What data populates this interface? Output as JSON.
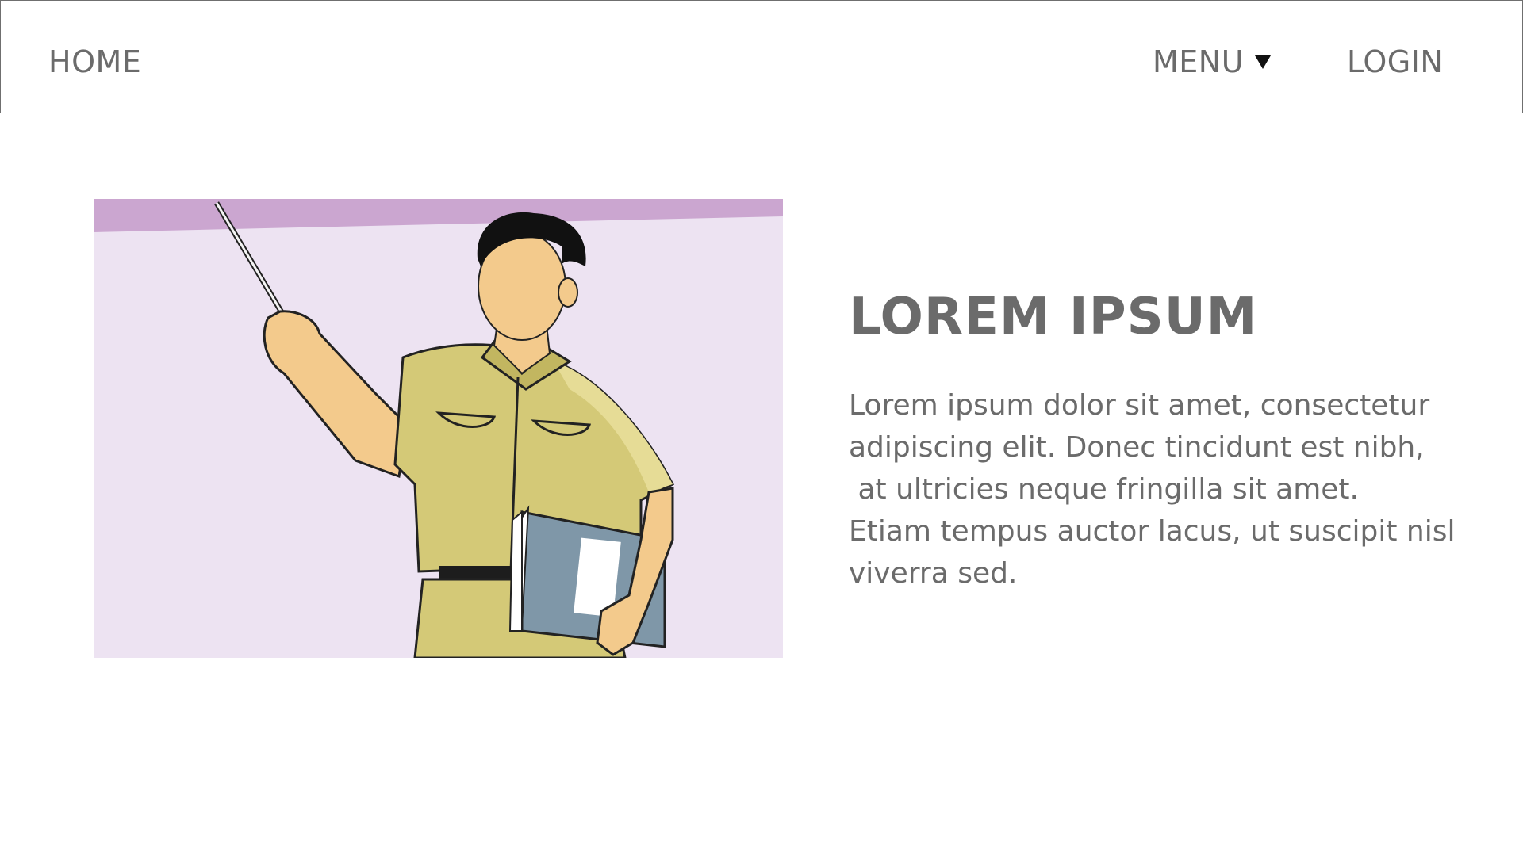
{
  "nav": {
    "home_label": "HOME",
    "menu_label": "MENU",
    "login_label": "LOGIN"
  },
  "hero": {
    "image_description_icon": "teacher-pointing-illustration"
  },
  "content": {
    "title": "LOREM IPSUM",
    "body_lines": [
      "Lorem ipsum dolor sit amet, consectetur",
      "adipiscing elit. Donec tincidunt est nibh,",
      " at ultricies neque fringilla sit amet.",
      "Etiam tempus auctor lacus, ut suscipit nisl",
      "viverra sed."
    ]
  },
  "colors": {
    "text_gray": "#6b6b6b",
    "illustration_bg": "#ede3f2",
    "illustration_stripe": "#cba6d0",
    "shirt": "#d4c977",
    "skin": "#f3ca8c",
    "folder": "#7f97a8"
  }
}
